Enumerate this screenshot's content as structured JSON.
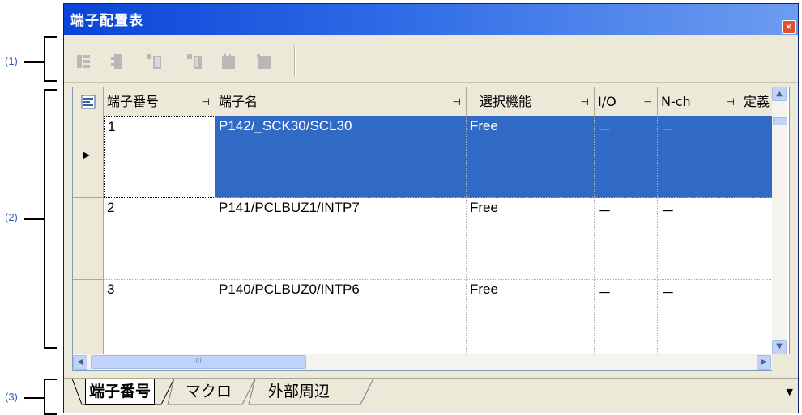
{
  "annotations": [
    "(1)",
    "(2)",
    "(3)"
  ],
  "window": {
    "title": "端子配置表",
    "close_glyph": "×"
  },
  "toolbar": {
    "buttons": [
      {
        "name": "toolbar-btn-1"
      },
      {
        "name": "toolbar-btn-2"
      },
      {
        "name": "toolbar-btn-3"
      },
      {
        "name": "toolbar-btn-4"
      },
      {
        "name": "toolbar-btn-5"
      },
      {
        "name": "toolbar-btn-6"
      }
    ]
  },
  "grid": {
    "columns": [
      "端子番号",
      "端子名",
      "選択機能",
      "I/O",
      "N-ch",
      "定義"
    ],
    "rows": [
      [
        "1",
        "P142/_SCK30/SCL30",
        "Free",
        "－",
        "－",
        ""
      ],
      [
        "2",
        "P141/PCLBUZ1/INTP7",
        "Free",
        "－",
        "－",
        ""
      ],
      [
        "3",
        "P140/PCLBUZ0/INTP6",
        "Free",
        "－",
        "－",
        ""
      ]
    ],
    "selected_row": 0,
    "row_indicator": "▶"
  },
  "hscroll": {
    "thumb_grip": "III"
  },
  "tabs": [
    "端子番号",
    "マクロ",
    "外部周辺"
  ],
  "colors": {
    "selection": "#316ac5",
    "titlebar": "#0a44d8",
    "annotation": "#2a5db0"
  }
}
